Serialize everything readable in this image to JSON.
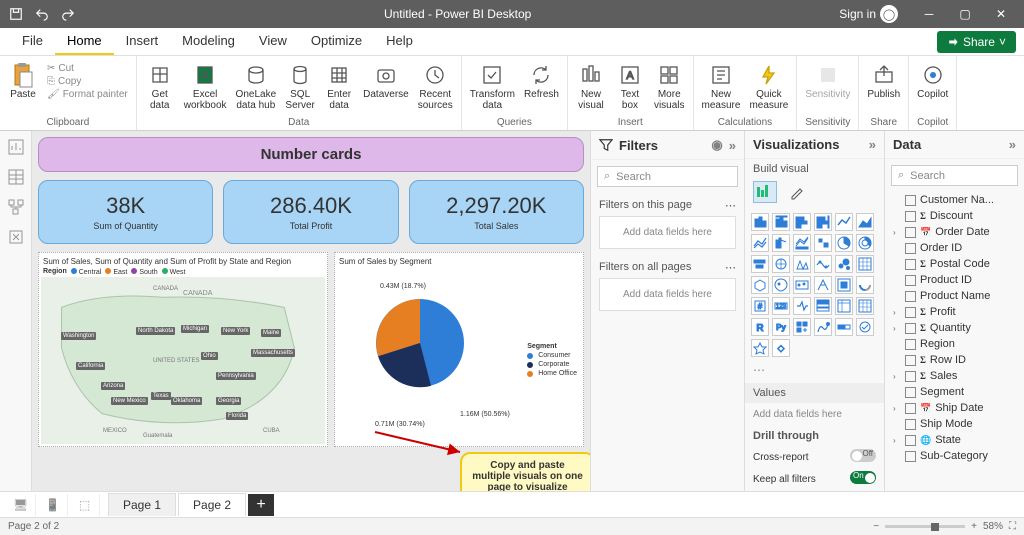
{
  "titlebar": {
    "title": "Untitled - Power BI Desktop",
    "signin": "Sign in"
  },
  "menus": [
    "File",
    "Home",
    "Insert",
    "Modeling",
    "View",
    "Optimize",
    "Help"
  ],
  "active_menu": 1,
  "share_label": "Share",
  "ribbon": {
    "clipboard": {
      "label": "Clipboard",
      "paste": "Paste",
      "cut": "Cut",
      "copy": "Copy",
      "fmt": "Format painter"
    },
    "data": {
      "label": "Data",
      "get": "Get\ndata",
      "excel": "Excel\nworkbook",
      "onelake": "OneLake\ndata hub",
      "sql": "SQL\nServer",
      "enter": "Enter\ndata",
      "dv": "Dataverse",
      "recent": "Recent\nsources"
    },
    "queries": {
      "label": "Queries",
      "transform": "Transform\ndata",
      "refresh": "Refresh"
    },
    "insert": {
      "label": "Insert",
      "newviz": "New\nvisual",
      "text": "Text\nbox",
      "more": "More\nvisuals"
    },
    "calc": {
      "label": "Calculations",
      "newm": "New\nmeasure",
      "quick": "Quick\nmeasure"
    },
    "sens": {
      "label": "Sensitivity",
      "btn": "Sensitivity"
    },
    "share": {
      "label": "Share",
      "btn": "Publish"
    },
    "copilot": {
      "label": "Copilot",
      "btn": "Copilot"
    }
  },
  "canvas": {
    "title_card": "Number cards",
    "kpis": [
      {
        "val": "38K",
        "lbl": "Sum of Quantity"
      },
      {
        "val": "286.40K",
        "lbl": "Total Profit"
      },
      {
        "val": "2,297.20K",
        "lbl": "Total Sales"
      }
    ],
    "map_title": "Sum of Sales, Sum of Quantity and Sum of Profit by State and Region",
    "map_legend_label": "Region",
    "map_regions": [
      "Central",
      "East",
      "South",
      "West"
    ],
    "map_region_colors": [
      "#2e7dd7",
      "#e67e22",
      "#8e44ad",
      "#27ae60"
    ],
    "map_states": [
      "CANADA",
      "Washington",
      "North Dakota",
      "Michigan",
      "New York",
      "Maine",
      "California",
      "UNITED STATES",
      "Ohio",
      "Massachusetts",
      "Arizona",
      "Texas",
      "Pennsylvania",
      "New Mexico",
      "Oklahoma",
      "Georgia",
      "Florida",
      "MEXICO",
      "Guatemala",
      "CUBA"
    ],
    "pie_title": "Sum of Sales by Segment",
    "pie_legend_label": "Segment",
    "pie_segments": [
      "Consumer",
      "Corporate",
      "Home Office"
    ],
    "pie_colors": [
      "#2e7dd7",
      "#1b2f5a",
      "#e67e22"
    ],
    "pie_labels": [
      "1.16M (50.56%)",
      "0.71M (30.74%)",
      "0.43M (18.7%)"
    ],
    "annotation": "Copy and paste multiple visuals on one page to visualize together"
  },
  "filters": {
    "title": "Filters",
    "search_ph": "Search",
    "on_page": "Filters on this page",
    "all_pages": "Filters on all pages",
    "drop": "Add data fields here"
  },
  "viz": {
    "title": "Visualizations",
    "build": "Build visual",
    "values": "Values",
    "values_drop": "Add data fields here",
    "drill": "Drill through",
    "cross": "Cross-report",
    "cross_state": "Off",
    "keep": "Keep all filters",
    "keep_state": "On"
  },
  "data": {
    "title": "Data",
    "search_ph": "Search",
    "fields": [
      {
        "name": "Customer Na...",
        "type": "text"
      },
      {
        "name": "Discount",
        "type": "sum"
      },
      {
        "name": "Order Date",
        "type": "date",
        "expandable": true
      },
      {
        "name": "Order ID",
        "type": "text"
      },
      {
        "name": "Postal Code",
        "type": "sum"
      },
      {
        "name": "Product ID",
        "type": "text"
      },
      {
        "name": "Product Name",
        "type": "text"
      },
      {
        "name": "Profit",
        "type": "sum",
        "expandable": true
      },
      {
        "name": "Quantity",
        "type": "sum",
        "expandable": true
      },
      {
        "name": "Region",
        "type": "text"
      },
      {
        "name": "Row ID",
        "type": "sum"
      },
      {
        "name": "Sales",
        "type": "sum",
        "expandable": true
      },
      {
        "name": "Segment",
        "type": "text"
      },
      {
        "name": "Ship Date",
        "type": "date",
        "expandable": true
      },
      {
        "name": "Ship Mode",
        "type": "text"
      },
      {
        "name": "State",
        "type": "geo",
        "expandable": true
      },
      {
        "name": "Sub-Category",
        "type": "text"
      }
    ]
  },
  "tabs": {
    "pages": [
      "Page 1",
      "Page 2"
    ],
    "active": 1
  },
  "status": {
    "page": "Page 2 of 2",
    "zoom": "58%"
  },
  "chart_data": [
    {
      "type": "pie",
      "title": "Sum of Sales by Segment",
      "series": [
        {
          "name": "Sales",
          "values": [
            1.16,
            0.71,
            0.43
          ]
        }
      ],
      "categories": [
        "Consumer",
        "Corporate",
        "Home Office"
      ],
      "percentages": [
        50.56,
        30.74,
        18.7
      ],
      "unit": "M"
    }
  ]
}
